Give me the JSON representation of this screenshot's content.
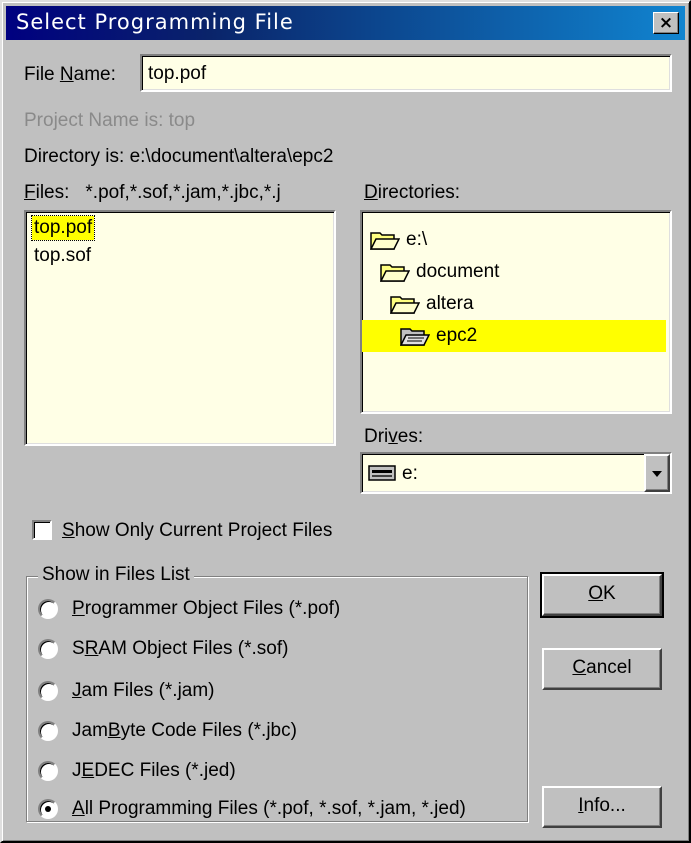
{
  "window": {
    "title": "Select Programming File",
    "close_glyph": "×"
  },
  "file_name": {
    "label_pre": "File ",
    "label_u": "N",
    "label_post": "ame:",
    "value": "top.pof"
  },
  "project_name": "Project Name is:  top",
  "directory": "Directory is:   e:\\document\\altera\\epc2",
  "files": {
    "label_u": "F",
    "label_post": "iles:",
    "filter": "*.pof,*.sof,*.jam,*.jbc,*.j",
    "items": [
      "top.pof",
      "top.sof"
    ],
    "selected_index": 0
  },
  "directories": {
    "label_u": "D",
    "label_post": "irectories:",
    "items": [
      "e:\\",
      "document",
      "altera",
      "epc2"
    ],
    "selected_index": 3
  },
  "drives": {
    "label_pre": "Dri",
    "label_u": "v",
    "label_post": "es:",
    "value": "e:"
  },
  "show_only": {
    "label_u": "S",
    "label_post": "how Only Current Project Files",
    "checked": false
  },
  "group": {
    "legend": "Show in Files List",
    "options": [
      {
        "pre": "",
        "u": "P",
        "post": "rogrammer Object Files (*.pof)",
        "checked": false
      },
      {
        "pre": "S",
        "u": "R",
        "post": "AM Object Files (*.sof)",
        "checked": false
      },
      {
        "pre": "",
        "u": "J",
        "post": "am Files (*.jam)",
        "checked": false
      },
      {
        "pre": "Jam ",
        "u": "B",
        "post": "yte Code Files (*.jbc)",
        "checked": false
      },
      {
        "pre": "J",
        "u": "E",
        "post": "DEC Files (*.jed)",
        "checked": false
      },
      {
        "pre": "",
        "u": "A",
        "post": "ll Programming Files (*.pof, *.sof, *.jam, *.jed)",
        "checked": true
      }
    ]
  },
  "buttons": {
    "ok": {
      "u": "O",
      "post": "K"
    },
    "cancel": {
      "u": "C",
      "post": "ancel"
    },
    "info": {
      "u": "I",
      "post": "nfo..."
    }
  },
  "colors": {
    "selection": "#ffff00",
    "list_bg": "#ffffe6",
    "dialog_bg": "#c0c0c0",
    "title_start": "#000080"
  },
  "icons": {
    "folder": "folder-icon",
    "drive": "drive-icon",
    "dropdown": "chevron-down-icon"
  }
}
